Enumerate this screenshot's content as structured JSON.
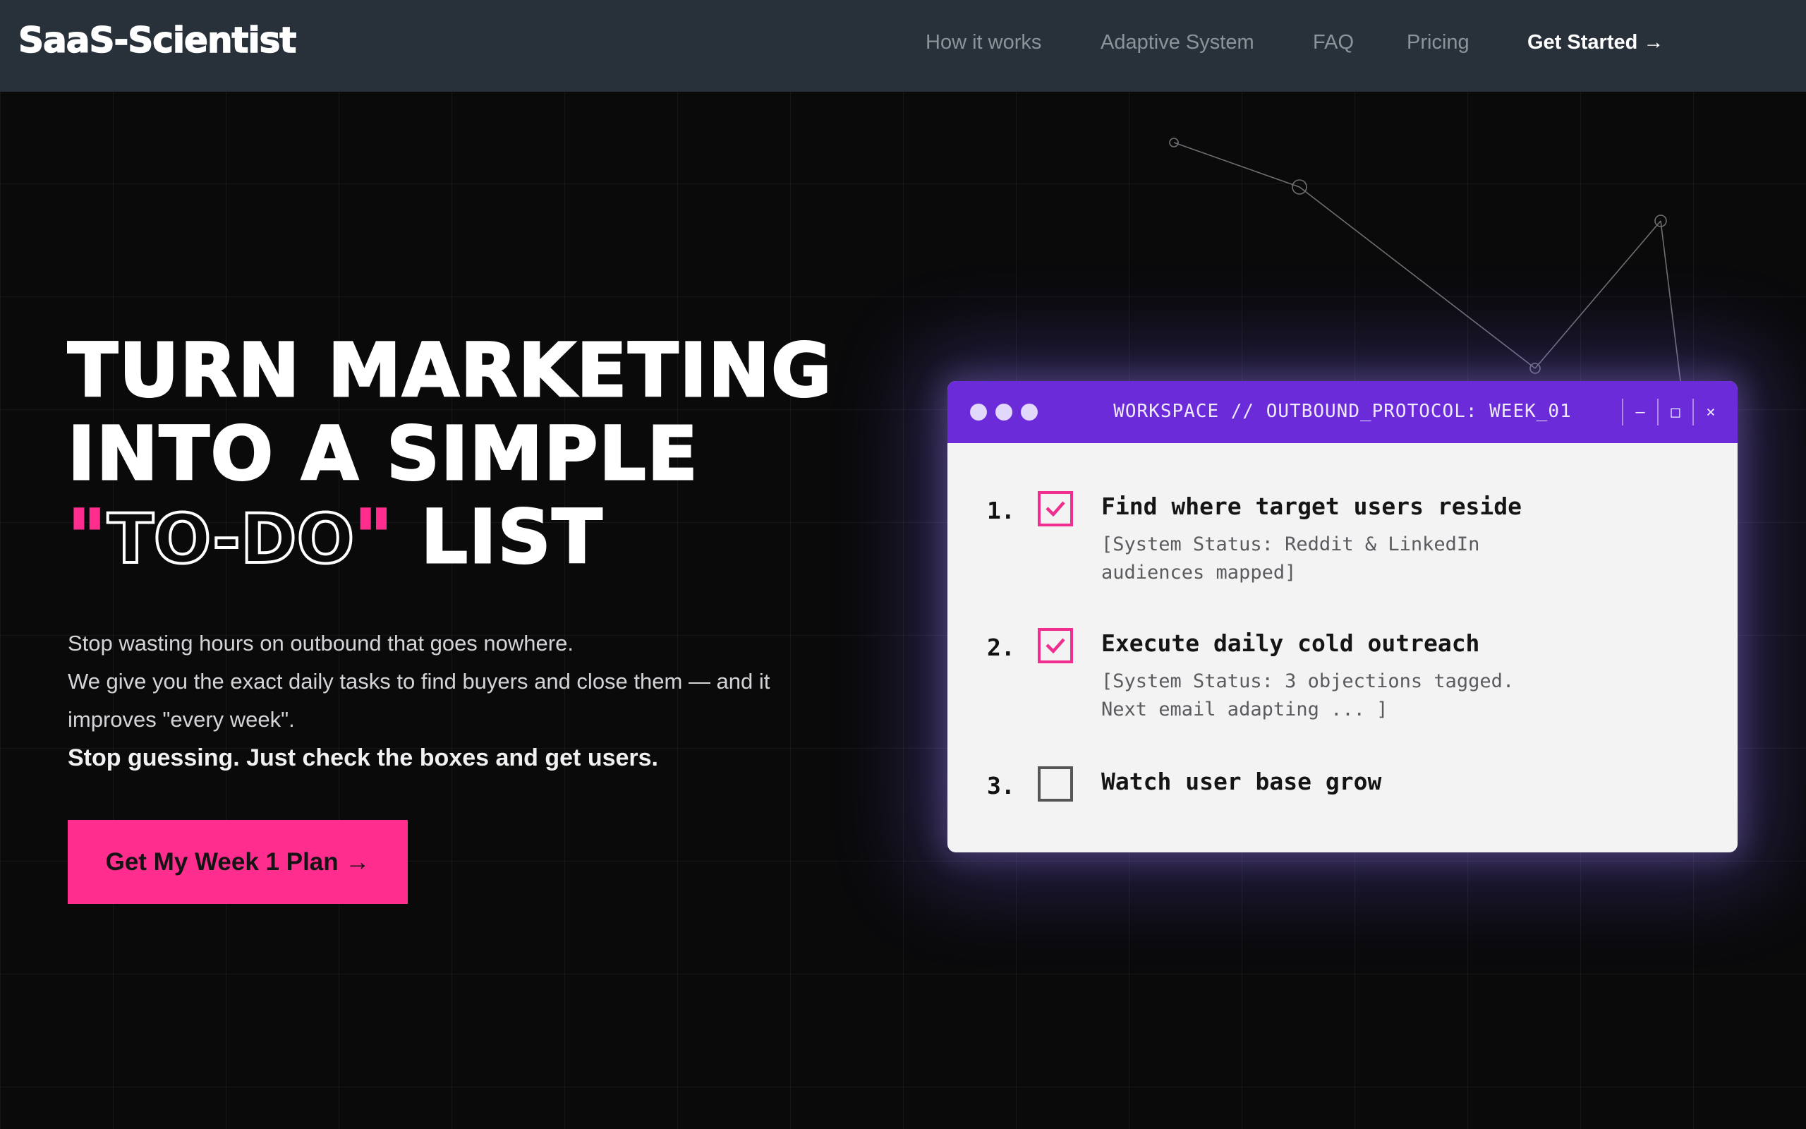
{
  "nav": {
    "logo": "SaaS-Scientist",
    "links": [
      "How it works",
      "Adaptive System",
      "FAQ",
      "Pricing"
    ],
    "cta": "Get Started →"
  },
  "hero": {
    "headline_line1": "TURN MARKETING",
    "headline_line2": "INTO A SIMPLE",
    "headline_quote_open": "\"",
    "headline_todo": "TO-DO",
    "headline_quote_close": "\"",
    "headline_list": "LIST",
    "sub_line1": "Stop wasting hours on outbound that goes nowhere.",
    "sub_line2": "We give you the exact daily tasks to find buyers and close them — and it improves \"every week\".",
    "tagline": "Stop guessing. Just check the boxes and get users.",
    "cta": "Get My Week 1 Plan →"
  },
  "workspace": {
    "title": "WORKSPACE // OUTBOUND_PROTOCOL: WEEK_01",
    "controls": [
      "–",
      "□",
      "×"
    ],
    "tasks": [
      {
        "number": "1.",
        "title": "Find where target users reside",
        "status": "[System Status: Reddit & LinkedIn audiences mapped]",
        "checked": true
      },
      {
        "number": "2.",
        "title": "Execute daily cold outreach",
        "status": "[System Status: 3 objections tagged. Next email adapting ... ]",
        "checked": true
      },
      {
        "number": "3.",
        "title": "Watch user base grow",
        "status": "",
        "checked": false
      }
    ]
  },
  "colors": {
    "accent_pink": "#ff2d8e",
    "window_purple": "#6c2bd9",
    "nav_bg": "#28313a",
    "page_bg": "#0a0a0b"
  },
  "icons": {
    "checkmark": "check-icon",
    "window_dots": "window-dot-icon"
  }
}
